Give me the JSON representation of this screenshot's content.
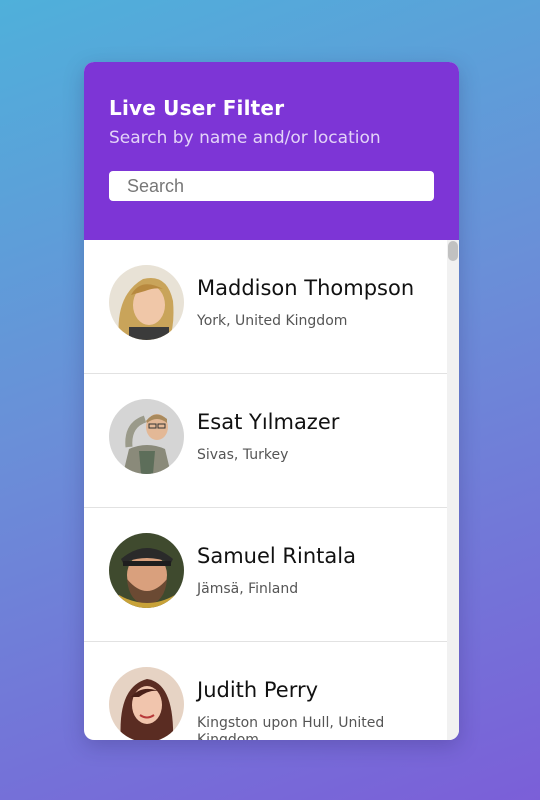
{
  "header": {
    "title": "Live User Filter",
    "subtitle": "Search by name and/or location",
    "search_placeholder": "Search"
  },
  "users": [
    {
      "name": "Maddison Thompson",
      "location": "York, United Kingdom",
      "avatar": "avatar-blonde-woman"
    },
    {
      "name": "Esat Yılmazer",
      "location": "Sivas, Turkey",
      "avatar": "avatar-man-glasses"
    },
    {
      "name": "Samuel Rintala",
      "location": "Jämsä, Finland",
      "avatar": "avatar-bearded-man-cap"
    },
    {
      "name": "Judith Perry",
      "location": "Kingston upon Hull, United Kingdom",
      "avatar": "avatar-brunette-woman"
    }
  ],
  "colors": {
    "header_bg": "#7d35d6",
    "gradient_start": "#4fb0da",
    "gradient_end": "#7b5fd8"
  }
}
